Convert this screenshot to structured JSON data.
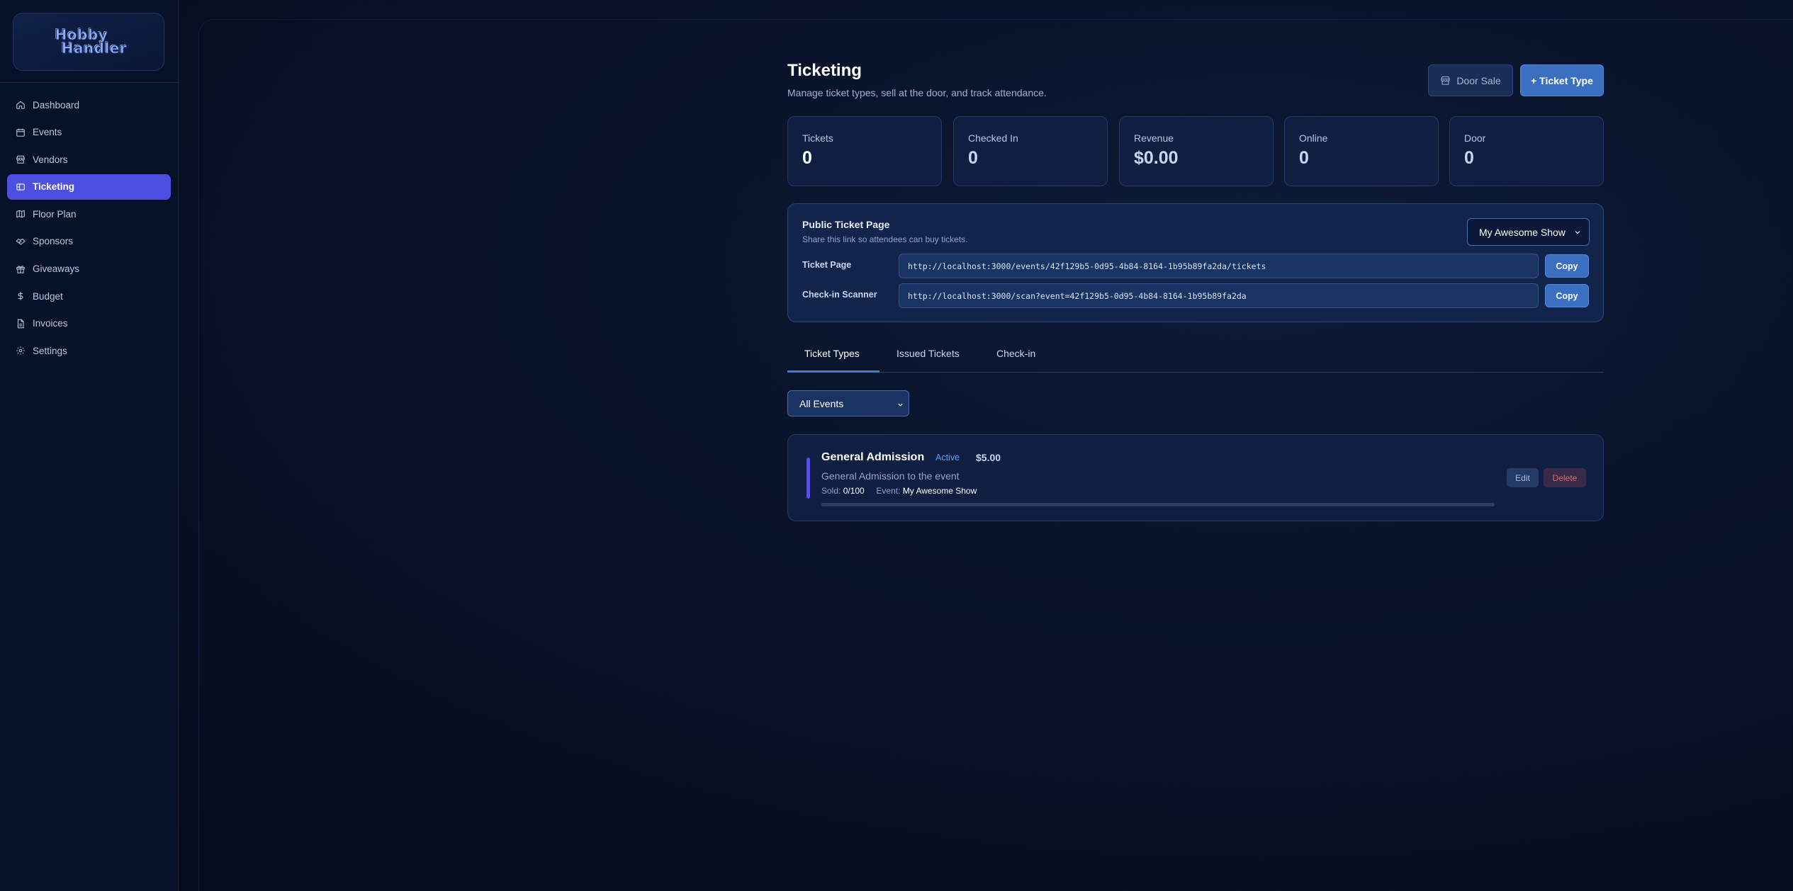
{
  "app": {
    "logo_line1": "Hobby",
    "logo_line2": "Handler"
  },
  "sidebar": {
    "items": [
      {
        "label": "Dashboard",
        "icon": "home-icon",
        "active": false
      },
      {
        "label": "Events",
        "icon": "calendar-icon",
        "active": false
      },
      {
        "label": "Vendors",
        "icon": "store-icon",
        "active": false
      },
      {
        "label": "Ticketing",
        "icon": "ticket-icon",
        "active": true
      },
      {
        "label": "Floor Plan",
        "icon": "map-icon",
        "active": false
      },
      {
        "label": "Sponsors",
        "icon": "handshake-icon",
        "active": false
      },
      {
        "label": "Giveaways",
        "icon": "gift-icon",
        "active": false
      },
      {
        "label": "Budget",
        "icon": "dollar-icon",
        "active": false
      },
      {
        "label": "Invoices",
        "icon": "file-icon",
        "active": false
      },
      {
        "label": "Settings",
        "icon": "gear-icon",
        "active": false
      }
    ]
  },
  "header": {
    "title": "Ticketing",
    "subtitle": "Manage ticket types, sell at the door, and track attendance.",
    "door_sale_label": "Door Sale",
    "add_ticket_type_label": "+ Ticket Type"
  },
  "stats": [
    {
      "label": "Tickets",
      "value": "0"
    },
    {
      "label": "Checked In",
      "value": "0"
    },
    {
      "label": "Revenue",
      "value": "$0.00"
    },
    {
      "label": "Online",
      "value": "0"
    },
    {
      "label": "Door",
      "value": "0"
    }
  ],
  "public_page": {
    "title": "Public Ticket Page",
    "subtitle": "Share this link so attendees can buy tickets.",
    "event_select_value": "My Awesome Show",
    "ticket_page_label": "Ticket Page",
    "ticket_page_url": "http://localhost:3000/events/42f129b5-0d95-4b84-8164-1b95b89fa2da/tickets",
    "scanner_label": "Check-in Scanner",
    "scanner_url": "http://localhost:3000/scan?event=42f129b5-0d95-4b84-8164-1b95b89fa2da",
    "copy_label": "Copy"
  },
  "tabs": [
    "Ticket Types",
    "Issued Tickets",
    "Check-in"
  ],
  "filter": {
    "value": "All Events"
  },
  "ticket_types": [
    {
      "name": "General Admission",
      "status": "Active",
      "price": "$5.00",
      "description": "General Admission to the event",
      "sold_label": "Sold:",
      "sold": "0/100",
      "sold_fraction": 0,
      "event_label": "Event:",
      "event": "My Awesome Show",
      "edit_label": "Edit",
      "delete_label": "Delete"
    }
  ],
  "colors": {
    "accent": "#4d4fe0",
    "primary_button": "#3b6fc2",
    "active_badge": "#5aa0ff",
    "delete": "#d96a6a"
  }
}
